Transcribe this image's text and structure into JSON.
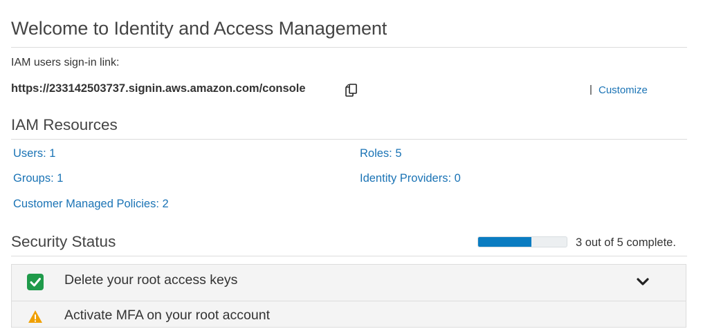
{
  "page": {
    "title": "Welcome to Identity and Access Management"
  },
  "signin": {
    "label": "IAM users sign-in link:",
    "url": "https://233142503737.signin.aws.amazon.com/console",
    "copy_icon": "copy-icon",
    "separator": "|",
    "customize_label": "Customize"
  },
  "resources": {
    "heading": "IAM Resources",
    "users": "Users: 1",
    "roles": "Roles: 5",
    "groups": "Groups: 1",
    "identity_providers": "Identity Providers: 0",
    "customer_managed_policies": "Customer Managed Policies: 2"
  },
  "security": {
    "heading": "Security Status",
    "progress_completed": 3,
    "progress_total": 5,
    "progress_text": "3 out of 5 complete.",
    "items": [
      {
        "label": "Delete your root access keys",
        "status": "complete",
        "icon": "check-icon"
      },
      {
        "label": "Activate MFA on your root account",
        "status": "warning",
        "icon": "warning-icon"
      }
    ]
  },
  "colors": {
    "link": "#1a73b5",
    "progress": "#0a7cc1",
    "check": "#1f9a4a",
    "warning": "#f0a000"
  }
}
